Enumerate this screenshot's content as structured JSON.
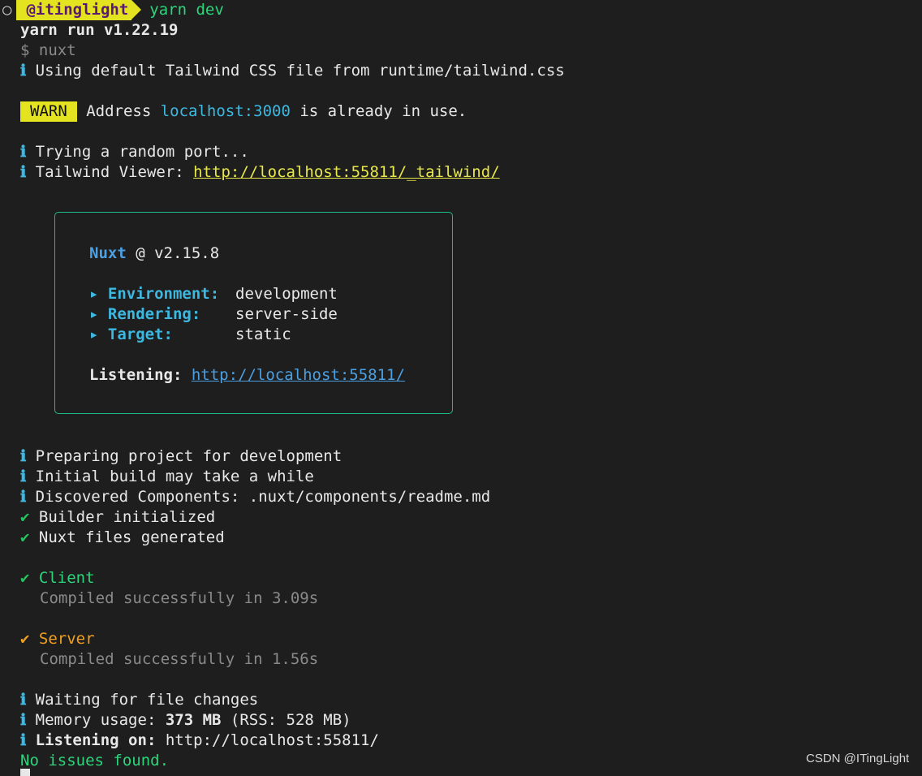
{
  "prompt": {
    "dot": "○",
    "user": "@itinglight",
    "command": "yarn dev"
  },
  "lines": {
    "yarn_run": "yarn run v1.22.19",
    "nuxt_cmd": "$ nuxt",
    "tailwind_css": "Using default Tailwind CSS file from runtime/tailwind.css",
    "warn_badge": "WARN",
    "warn_pre": "Address ",
    "warn_host": "localhost:3000",
    "warn_post": " is already in use.",
    "trying_port": "Trying a random port...",
    "viewer_label": "Tailwind Viewer: ",
    "viewer_url": "http://localhost:55811/_tailwind/"
  },
  "nuxt_box": {
    "name": "Nuxt",
    "version": " @ v2.15.8",
    "bullet": "▸",
    "env_label": "Environment:",
    "env_value": "development",
    "render_label": "Rendering:",
    "render_value": "server-side",
    "target_label": "Target:",
    "target_value": "static",
    "listening_label": "Listening:",
    "listening_url": "http://localhost:55811/"
  },
  "build": {
    "info_glyph": "ℹ",
    "check_glyph": "✔",
    "preparing": "Preparing project for development",
    "initial_build": "Initial build may take a while",
    "discovered": "Discovered Components: .nuxt/components/readme.md",
    "builder_init": "Builder initialized",
    "nuxt_files": "Nuxt files generated",
    "client_label": "Client",
    "client_compiled": "Compiled successfully in 3.09s",
    "server_label": "Server",
    "server_compiled": "Compiled successfully in 1.56s",
    "waiting": "Waiting for file changes",
    "memory_label": "Memory usage: ",
    "memory_value": "373 MB",
    "memory_rss": " (RSS: 528 MB)",
    "listening_on_label": "Listening on:",
    "listening_on_url": " http://localhost:55811/",
    "no_issues": "No issues found."
  },
  "watermark": "CSDN @ITingLight",
  "colors": {
    "background": "#1e1e1e",
    "prompt_bg": "#e3e31f",
    "info_icon": "#3db8e0",
    "success": "#22c55e",
    "server_orange": "#f0a020",
    "box_border": "#1fb88a",
    "link_blue": "#4c9fe0"
  }
}
